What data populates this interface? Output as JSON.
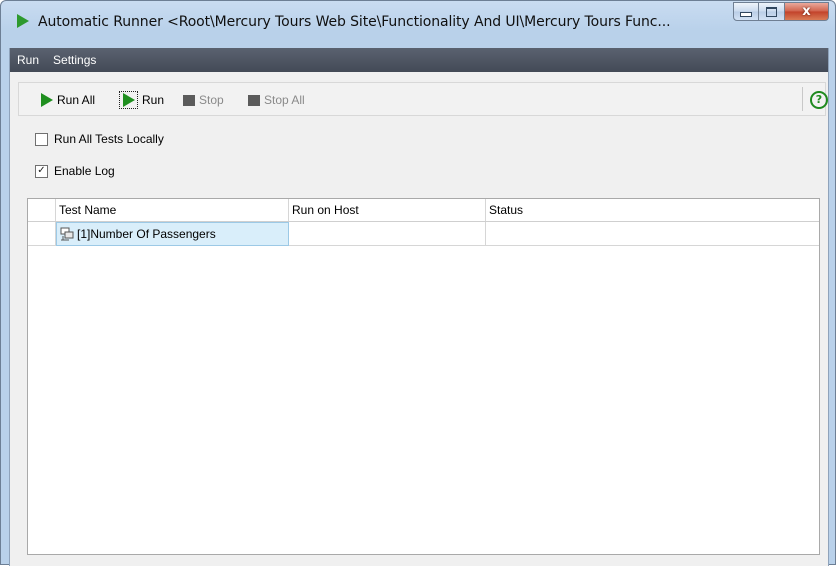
{
  "window": {
    "title": "Automatic Runner <Root\\Mercury Tours Web Site\\Functionality And UI\\Mercury Tours Func...",
    "close_glyph": "x",
    "colors": {
      "accent": "#2e9a2e",
      "menubar": "#4a515d",
      "selection": "#d9eefa"
    }
  },
  "menu": {
    "items": [
      "Run",
      "Settings"
    ]
  },
  "toolbar": {
    "run_all_label": "Run All",
    "run_label": "Run",
    "stop_label": "Stop",
    "stop_all_label": "Stop All",
    "help_glyph": "?"
  },
  "options": {
    "run_locally": {
      "label": "Run All Tests Locally",
      "checked": false
    },
    "enable_log": {
      "label": "Enable Log",
      "checked": true,
      "mark": "✓"
    }
  },
  "grid": {
    "columns": [
      "",
      "Test Name",
      "Run on Host",
      "Status"
    ],
    "rows": [
      {
        "test_name": "[1]Number Of Passengers",
        "run_on_host": "",
        "status": ""
      }
    ]
  }
}
